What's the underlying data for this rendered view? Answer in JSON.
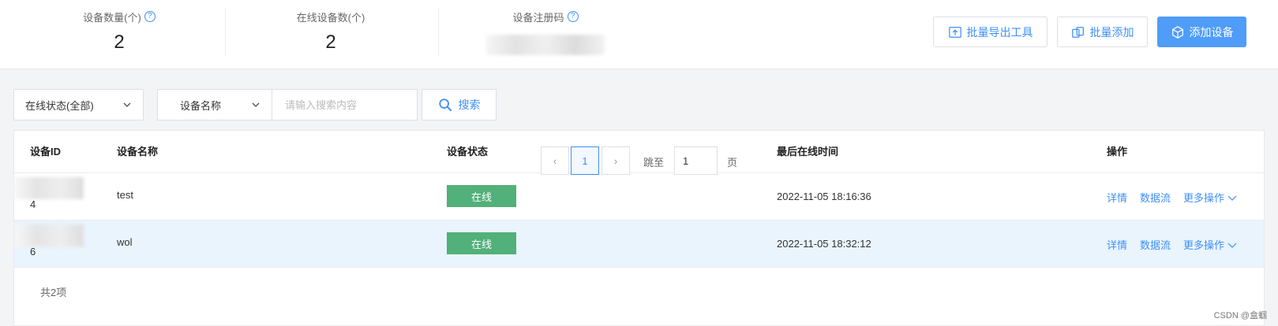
{
  "stats": [
    {
      "label": "设备数量(个)",
      "value": "2",
      "help": "?"
    },
    {
      "label": "在线设备数(个)",
      "value": "2"
    },
    {
      "label": "设备注册码",
      "help": "?"
    }
  ],
  "toolbar": {
    "export_label": "批量导出工具",
    "batch_add_label": "批量添加",
    "add_device_label": "添加设备"
  },
  "filters": {
    "status_select": "在线状态(全部)",
    "field_select": "设备名称",
    "search_placeholder": "请输入搜索内容",
    "search_button": "搜索"
  },
  "table": {
    "columns": [
      "设备ID",
      "设备名称",
      "设备状态",
      "最后在线时间",
      "操作"
    ],
    "rows": [
      {
        "id_suffix": "4",
        "name": "test",
        "status": "在线",
        "last_online": "2022-11-05 18:16:36"
      },
      {
        "id_suffix": "6",
        "name": "wol",
        "status": "在线",
        "last_online": "2022-11-05 18:32:12"
      }
    ],
    "actions": {
      "detail": "详情",
      "datastream": "数据流",
      "more": "更多操作"
    }
  },
  "pagination": {
    "total_text": "共2项",
    "prev": "‹",
    "current_page": "1",
    "next": "›",
    "jump_to": "跳至",
    "jump_value": "1",
    "page_unit": "页"
  },
  "watermark": "CSDN @盒蝈",
  "colors": {
    "accent": "#3f8ff7",
    "primary_button": "#4f9df8",
    "online_badge": "#52b07a",
    "highlight_row": "#e9f4fd"
  }
}
